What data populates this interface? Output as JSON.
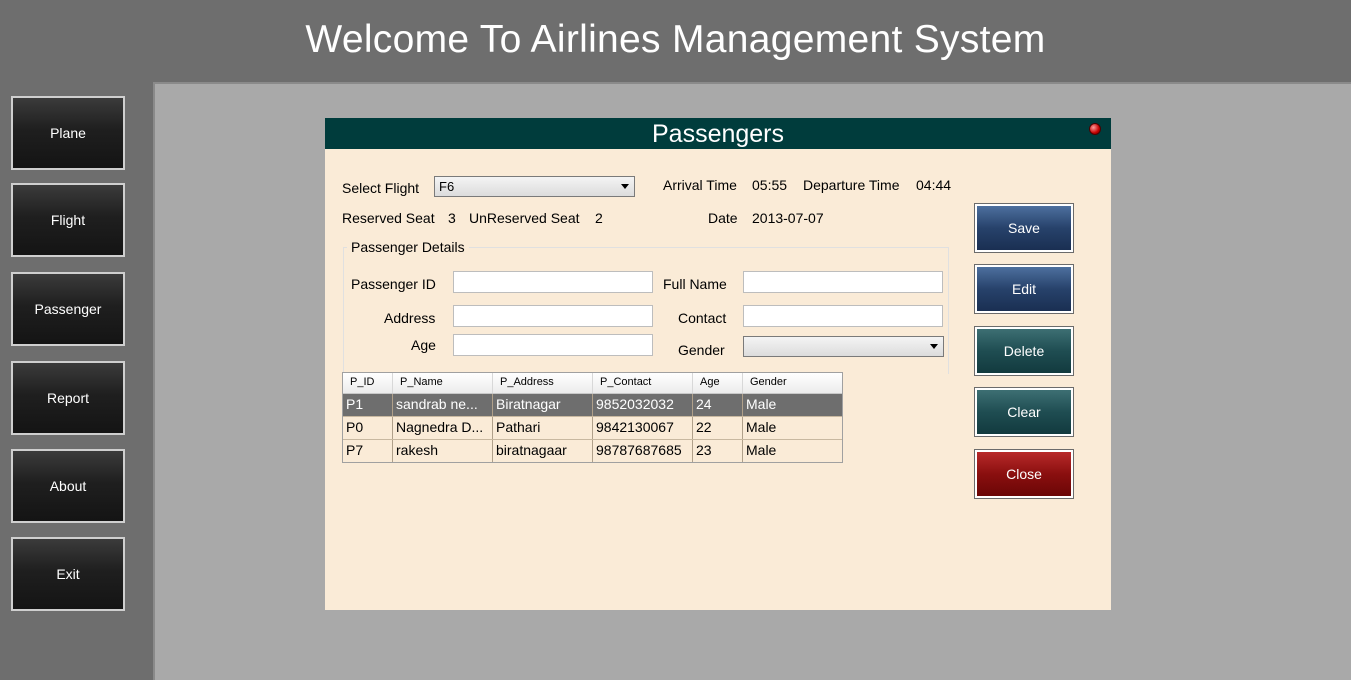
{
  "header": {
    "title": "Welcome To Airlines Management System"
  },
  "sidebar": {
    "items": [
      {
        "label": "Plane"
      },
      {
        "label": "Flight"
      },
      {
        "label": "Passenger"
      },
      {
        "label": "Report"
      },
      {
        "label": "About"
      },
      {
        "label": "Exit"
      }
    ]
  },
  "form": {
    "title": "Passengers",
    "select_flight_label": "Select Flight",
    "select_flight_value": "F6",
    "arrival_time_label": "Arrival Time",
    "arrival_time_value": "05:55",
    "departure_time_label": "Departure Time",
    "departure_time_value": "04:44",
    "reserved_seat_label": "Reserved Seat",
    "reserved_seat_value": "3",
    "unreserved_seat_label": "UnReserved Seat",
    "unreserved_seat_value": "2",
    "date_label": "Date",
    "date_value": "2013-07-07",
    "group_title": "Passenger Details",
    "fields": {
      "passenger_id_label": "Passenger ID",
      "passenger_id_value": "",
      "full_name_label": "Full Name",
      "full_name_value": "",
      "address_label": "Address",
      "address_value": "",
      "contact_label": "Contact",
      "contact_value": "",
      "age_label": "Age",
      "age_value": "",
      "gender_label": "Gender",
      "gender_value": ""
    },
    "table": {
      "columns": [
        "P_ID",
        "P_Name",
        "P_Address",
        "P_Contact",
        "Age",
        "Gender"
      ],
      "rows": [
        [
          "P1",
          "sandrab ne...",
          "Biratnagar",
          "9852032032",
          "24",
          "Male"
        ],
        [
          "P0",
          "Nagnedra D...",
          "Pathari",
          "9842130067",
          "22",
          "Male"
        ],
        [
          "P7",
          "rakesh",
          "biratnagaar",
          "98787687685",
          "23",
          "Male"
        ]
      ]
    },
    "buttons": {
      "save": "Save",
      "edit": "Edit",
      "delete": "Delete",
      "clear": "Clear",
      "close": "Close"
    }
  }
}
